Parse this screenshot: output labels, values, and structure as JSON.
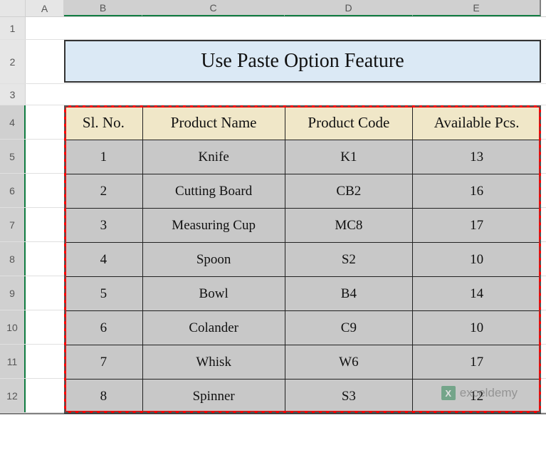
{
  "columns": [
    "A",
    "B",
    "C",
    "D",
    "E"
  ],
  "row_numbers": [
    1,
    2,
    3,
    4,
    5,
    6,
    7,
    8,
    9,
    10,
    11,
    12
  ],
  "title": "Use Paste Option Feature",
  "headers": {
    "sl": "Sl. No.",
    "name": "Product Name",
    "code": "Product Code",
    "pcs": "Available Pcs."
  },
  "rows": [
    {
      "sl": "1",
      "name": "Knife",
      "code": "K1",
      "pcs": "13"
    },
    {
      "sl": "2",
      "name": "Cutting Board",
      "code": "CB2",
      "pcs": "16"
    },
    {
      "sl": "3",
      "name": "Measuring Cup",
      "code": "MC8",
      "pcs": "17"
    },
    {
      "sl": "4",
      "name": "Spoon",
      "code": "S2",
      "pcs": "10"
    },
    {
      "sl": "5",
      "name": "Bowl",
      "code": "B4",
      "pcs": "14"
    },
    {
      "sl": "6",
      "name": "Colander",
      "code": "C9",
      "pcs": "10"
    },
    {
      "sl": "7",
      "name": "Whisk",
      "code": "W6",
      "pcs": "17"
    },
    {
      "sl": "8",
      "name": "Spinner",
      "code": "S3",
      "pcs": "12"
    }
  ],
  "watermark": "exceldemy",
  "watermark_icon": "X",
  "chart_data": {
    "type": "table",
    "title": "Use Paste Option Feature",
    "columns": [
      "Sl. No.",
      "Product Name",
      "Product Code",
      "Available Pcs."
    ],
    "data": [
      [
        1,
        "Knife",
        "K1",
        13
      ],
      [
        2,
        "Cutting Board",
        "CB2",
        16
      ],
      [
        3,
        "Measuring Cup",
        "MC8",
        17
      ],
      [
        4,
        "Spoon",
        "S2",
        10
      ],
      [
        5,
        "Bowl",
        "B4",
        14
      ],
      [
        6,
        "Colander",
        "C9",
        10
      ],
      [
        7,
        "Whisk",
        "W6",
        17
      ],
      [
        8,
        "Spinner",
        "S3",
        12
      ]
    ]
  }
}
